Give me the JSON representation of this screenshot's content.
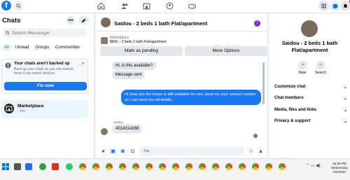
{
  "topbar": {
    "logo_letter": "f",
    "notifications_badge": "4"
  },
  "sidebar": {
    "title": "Chats",
    "search_placeholder": "Search Messenger",
    "tabs": [
      "All",
      "Unread",
      "Groups",
      "Communities"
    ],
    "backup": {
      "title": "Your chats aren't backed up",
      "desc": "Back up your chats so you can restore them if you switch devices.",
      "button": "Fix now"
    },
    "chat_item": {
      "name": "Marketplace",
      "sub": "· 1m"
    }
  },
  "chat": {
    "title": "Saidou - 2 beds 1 bath Flat/apartment",
    "marketplace_label": "Marketplace",
    "listing": "$600 – 2 beds 1 bath Flat/apartment",
    "mark_pending": "Mark as pending",
    "more_options": "More Options",
    "msg_in1": "Hi, is this available?",
    "msg_in2": "Message sent",
    "msg_out": "Hi Dear yes the house is still available for rent, send me your contact number so i can send you all details.",
    "sender": "Saidou",
    "msg_in3": "4014314268",
    "composer_placeholder": "Aa"
  },
  "info": {
    "name": "Saidou - 2 beds 1 bath Flat/apartment",
    "mute": "Mute",
    "search": "Search",
    "options": [
      "Customize chat",
      "Chat members",
      "Media, files and links",
      "Privacy & support"
    ]
  },
  "taskbar": {
    "time": "06:38 PM",
    "day": "Wednesday",
    "date": "6/3/2020"
  }
}
